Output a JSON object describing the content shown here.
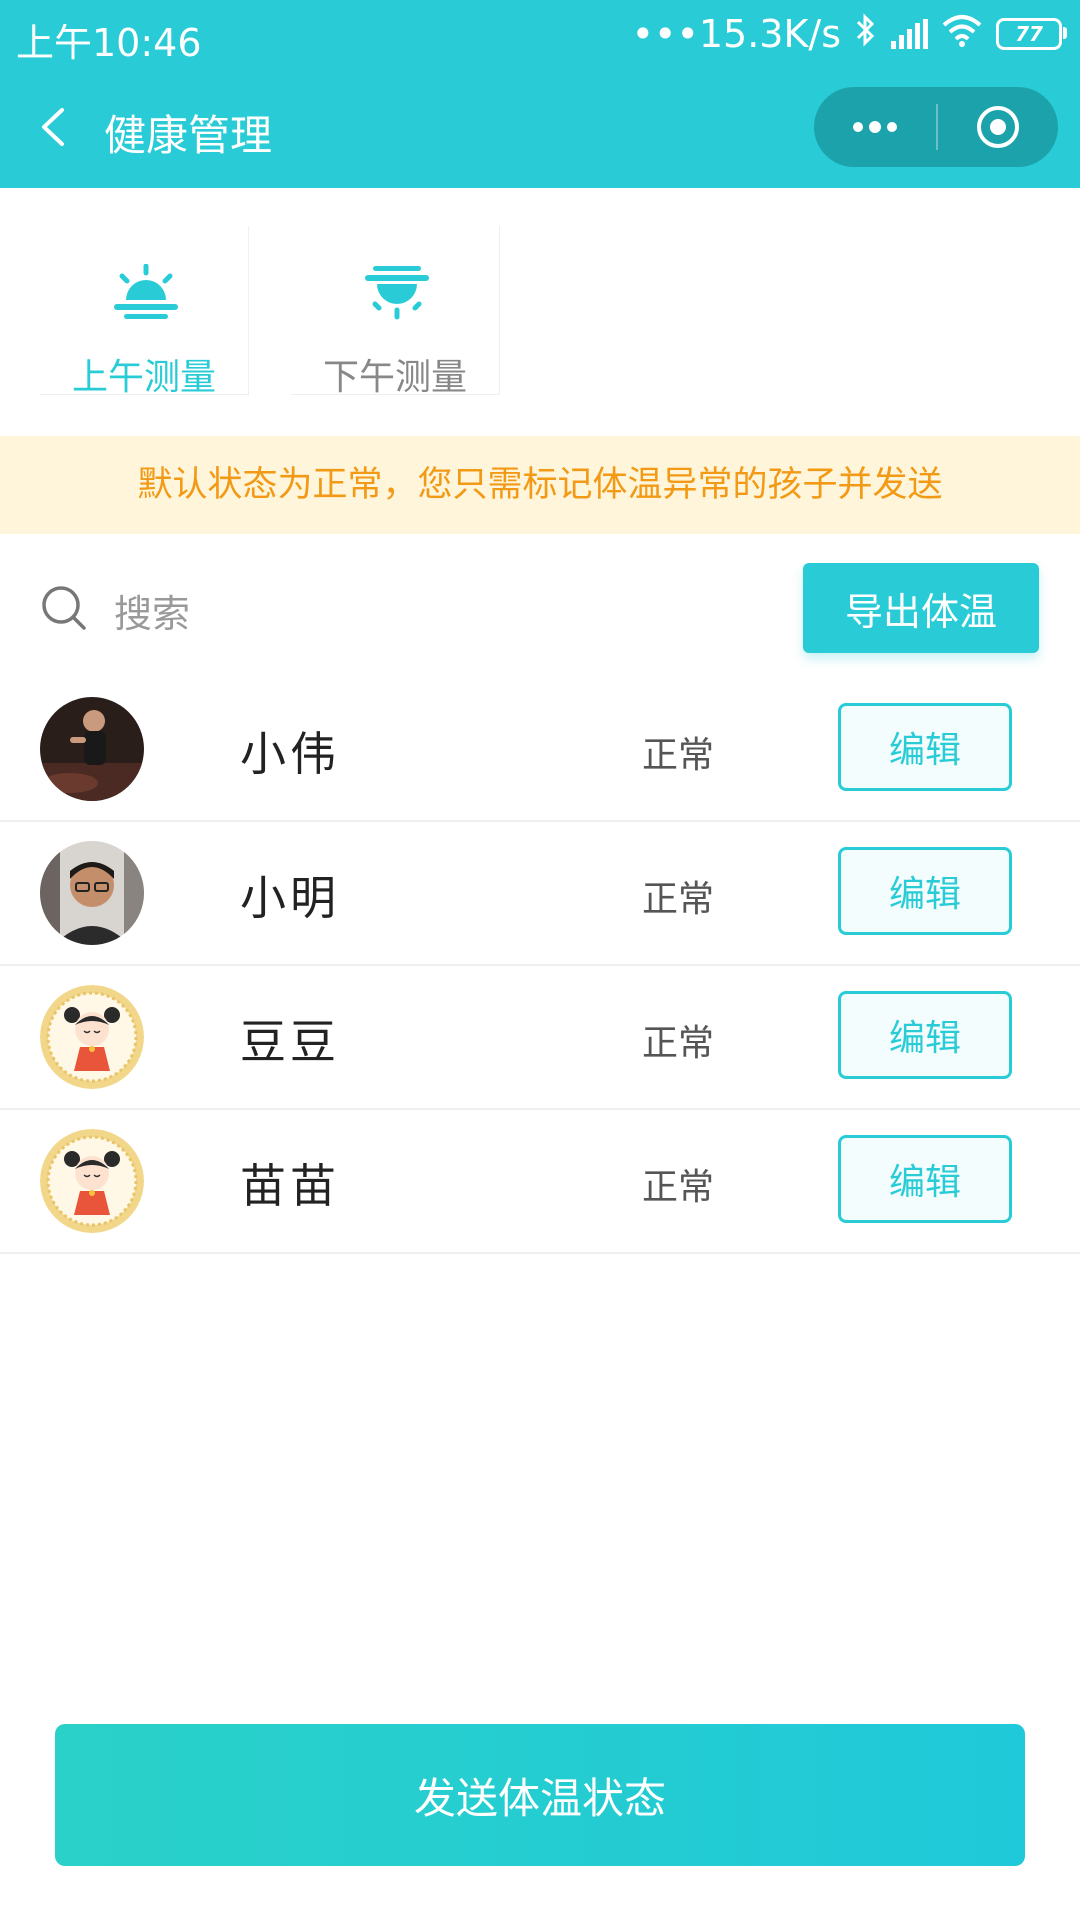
{
  "status_bar": {
    "time": "上午10:46",
    "network_speed": "•••15.3K/s",
    "battery": "77"
  },
  "nav": {
    "title": "健康管理"
  },
  "tabs": [
    {
      "label": "上午测量",
      "active": true
    },
    {
      "label": "下午测量",
      "active": false
    }
  ],
  "notice": "默认状态为正常，您只需标记体温异常的孩子并发送",
  "search": {
    "placeholder": "搜索"
  },
  "export_button": "导出体温",
  "children": [
    {
      "name": "小伟",
      "status": "正常",
      "edit_label": "编辑",
      "avatar": "photo-man-avatar"
    },
    {
      "name": "小明",
      "status": "正常",
      "edit_label": "编辑",
      "avatar": "photo-man-glasses-avatar"
    },
    {
      "name": "豆豆",
      "status": "正常",
      "edit_label": "编辑",
      "avatar": "cartoon-girl-avatar"
    },
    {
      "name": "苗苗",
      "status": "正常",
      "edit_label": "编辑",
      "avatar": "cartoon-girl-avatar"
    }
  ],
  "send_button": "发送体温状态",
  "colors": {
    "primary": "#29ccd6",
    "notice_bg": "#fff5da",
    "notice_text": "#f29a16"
  }
}
